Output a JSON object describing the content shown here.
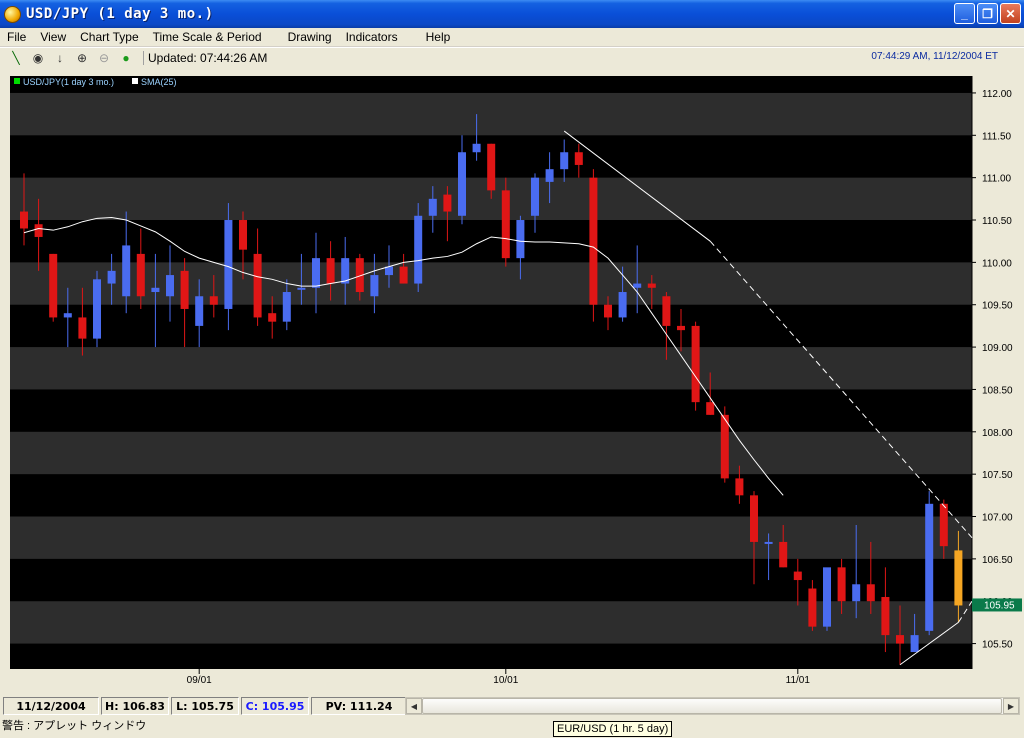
{
  "window": {
    "title": "USD/JPY (1 day 3 mo.)",
    "minimize": "_",
    "restore": "❐",
    "close": "✕"
  },
  "menu": [
    "File",
    "View",
    "Chart Type",
    "Time Scale & Period",
    "Drawing",
    "Indicators",
    "Help"
  ],
  "toolbar": {
    "tools": [
      {
        "name": "trendline-tool-icon",
        "glyph": "╲"
      },
      {
        "name": "crosshair-tool-icon",
        "glyph": "◉"
      },
      {
        "name": "down-arrow-tool-icon",
        "glyph": "↓"
      },
      {
        "name": "zoom-in-icon",
        "glyph": "⊕"
      },
      {
        "name": "zoom-out-icon",
        "glyph": "⊖"
      },
      {
        "name": "status-light-icon",
        "glyph": "●"
      }
    ],
    "updated": "Updated: 07:44:26 AM"
  },
  "clock": "07:44:29 AM, 11/12/2004 ET",
  "status": {
    "date": "11/12/2004",
    "high": "H: 106.83",
    "low": "L: 105.75",
    "close": "C: 105.95",
    "pv": "PV: 111.24"
  },
  "applet_warning": "警告 : アプレット ウィンドウ",
  "tooltip": "EUR/USD (1 hr. 5 day)",
  "colors": {
    "background": "#000000",
    "band": "#2d2d2d",
    "up": "#4a6cf0",
    "down": "#e01616",
    "current": "#f5a623",
    "sma": "#ffffff",
    "price_tag": "#0a7a4a"
  },
  "chart_data": {
    "type": "candlestick",
    "legend": [
      {
        "label": "USD/JPY(1 day 3 mo.)",
        "color": "#00dd00"
      },
      {
        "label": "SMA(25)",
        "color": "#ffffff"
      }
    ],
    "ylim": [
      105.2,
      112.2
    ],
    "yticks": [
      "112.00",
      "111.50",
      "111.00",
      "110.50",
      "110.00",
      "109.50",
      "109.00",
      "108.50",
      "108.00",
      "107.50",
      "107.00",
      "106.50",
      "106.00",
      "105.50"
    ],
    "xticks": [
      {
        "label": "09/01",
        "index": 12
      },
      {
        "label": "10/01",
        "index": 33
      },
      {
        "label": "11/01",
        "index": 53
      }
    ],
    "last_price": "105.95",
    "candles": [
      [
        110.6,
        111.05,
        110.2,
        110.4
      ],
      [
        110.45,
        110.75,
        109.9,
        110.3
      ],
      [
        110.1,
        110.1,
        109.3,
        109.35
      ],
      [
        109.35,
        109.7,
        109.0,
        109.4
      ],
      [
        109.35,
        109.7,
        108.9,
        109.1
      ],
      [
        109.1,
        109.9,
        109.0,
        109.8
      ],
      [
        109.75,
        110.1,
        109.5,
        109.9
      ],
      [
        109.6,
        110.6,
        109.4,
        110.2
      ],
      [
        110.1,
        110.4,
        109.45,
        109.6
      ],
      [
        109.65,
        110.1,
        109.0,
        109.7
      ],
      [
        109.6,
        110.2,
        109.3,
        109.85
      ],
      [
        109.9,
        110.05,
        109.0,
        109.45
      ],
      [
        109.25,
        109.8,
        109.0,
        109.6
      ],
      [
        109.6,
        109.85,
        109.35,
        109.5
      ],
      [
        109.45,
        110.7,
        109.2,
        110.5
      ],
      [
        110.5,
        110.6,
        109.8,
        110.15
      ],
      [
        110.1,
        110.4,
        109.25,
        109.35
      ],
      [
        109.4,
        109.6,
        109.1,
        109.3
      ],
      [
        109.3,
        109.8,
        109.2,
        109.65
      ],
      [
        109.7,
        110.1,
        109.5,
        109.7
      ],
      [
        109.7,
        110.35,
        109.4,
        110.05
      ],
      [
        110.05,
        110.25,
        109.55,
        109.75
      ],
      [
        109.75,
        110.3,
        109.5,
        110.05
      ],
      [
        110.05,
        110.1,
        109.55,
        109.65
      ],
      [
        109.6,
        110.1,
        109.4,
        109.85
      ],
      [
        109.85,
        110.2,
        109.7,
        109.95
      ],
      [
        109.95,
        110.1,
        109.75,
        109.75
      ],
      [
        109.75,
        110.7,
        109.65,
        110.55
      ],
      [
        110.55,
        110.9,
        110.35,
        110.75
      ],
      [
        110.8,
        110.9,
        110.25,
        110.6
      ],
      [
        110.55,
        111.5,
        110.45,
        111.3
      ],
      [
        111.3,
        111.75,
        111.2,
        111.4
      ],
      [
        111.4,
        111.4,
        110.75,
        110.85
      ],
      [
        110.85,
        111.0,
        109.95,
        110.05
      ],
      [
        110.05,
        110.55,
        109.8,
        110.5
      ],
      [
        110.55,
        111.05,
        110.35,
        111.0
      ],
      [
        110.95,
        111.3,
        110.7,
        111.1
      ],
      [
        111.1,
        111.45,
        110.95,
        111.3
      ],
      [
        111.3,
        111.4,
        111.0,
        111.15
      ],
      [
        111.0,
        111.1,
        109.3,
        109.5
      ],
      [
        109.5,
        109.6,
        109.2,
        109.35
      ],
      [
        109.35,
        109.95,
        109.3,
        109.65
      ],
      [
        109.7,
        110.2,
        109.4,
        109.75
      ],
      [
        109.75,
        109.85,
        109.45,
        109.7
      ],
      [
        109.6,
        109.65,
        108.85,
        109.25
      ],
      [
        109.25,
        109.45,
        108.95,
        109.2
      ],
      [
        109.25,
        109.3,
        108.25,
        108.35
      ],
      [
        108.35,
        108.7,
        108.2,
        108.2
      ],
      [
        108.2,
        108.3,
        107.4,
        107.45
      ],
      [
        107.45,
        107.6,
        107.15,
        107.25
      ],
      [
        107.25,
        107.3,
        106.2,
        106.7
      ],
      [
        106.7,
        106.8,
        106.25,
        106.7
      ],
      [
        106.7,
        106.9,
        106.4,
        106.4
      ],
      [
        106.35,
        106.5,
        105.95,
        106.25
      ],
      [
        106.15,
        106.25,
        105.65,
        105.7
      ],
      [
        105.7,
        106.3,
        105.65,
        106.4
      ],
      [
        106.4,
        106.5,
        105.85,
        106.0
      ],
      [
        106.0,
        106.9,
        105.8,
        106.2
      ],
      [
        106.2,
        106.7,
        105.85,
        106.0
      ],
      [
        106.05,
        106.4,
        105.4,
        105.6
      ],
      [
        105.6,
        105.95,
        105.25,
        105.5
      ],
      [
        105.4,
        105.85,
        105.4,
        105.6
      ],
      [
        105.65,
        107.3,
        105.6,
        107.15
      ],
      [
        107.15,
        107.2,
        106.5,
        106.65
      ],
      [
        106.6,
        106.83,
        105.75,
        105.95
      ]
    ],
    "sma": [
      110.35,
      110.4,
      110.38,
      110.42,
      110.48,
      110.52,
      110.53,
      110.5,
      110.43,
      110.36,
      110.25,
      110.13,
      110.05,
      110.0,
      109.95,
      109.88,
      109.83,
      109.8,
      109.75,
      109.72,
      109.72,
      109.75,
      109.78,
      109.84,
      109.9,
      109.95,
      110.0,
      110.02,
      110.05,
      110.07,
      110.12,
      110.22,
      110.3,
      110.28,
      110.25,
      110.24,
      110.24,
      110.23,
      110.22,
      110.18,
      110.05,
      109.85,
      109.65,
      109.4,
      109.15,
      108.9,
      108.65,
      108.4,
      108.15,
      107.9,
      107.67,
      107.45,
      107.25
    ]
  }
}
